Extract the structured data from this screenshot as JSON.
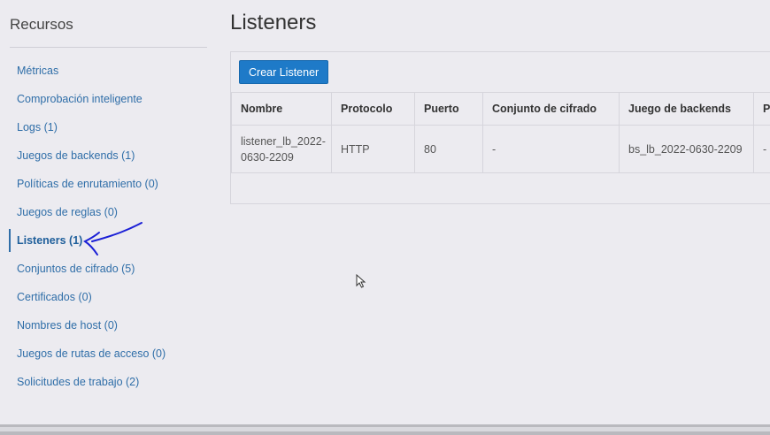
{
  "sidebar": {
    "title": "Recursos",
    "items": [
      {
        "label": "Métricas"
      },
      {
        "label": "Comprobación inteligente"
      },
      {
        "label": "Logs (1)"
      },
      {
        "label": "Juegos de backends (1)"
      },
      {
        "label": "Políticas de enrutamiento (0)"
      },
      {
        "label": "Juegos de reglas (0)"
      },
      {
        "label": "Listeners (1)",
        "active": true
      },
      {
        "label": "Conjuntos de cifrado (5)"
      },
      {
        "label": "Certificados (0)"
      },
      {
        "label": "Nombres de host (0)"
      },
      {
        "label": "Juegos de rutas de acceso (0)"
      },
      {
        "label": "Solicitudes de trabajo (2)"
      }
    ]
  },
  "main": {
    "title": "Listeners",
    "create_button": "Crear Listener",
    "table": {
      "headers": [
        "Nombre",
        "Protocolo",
        "Puerto",
        "Conjunto de cifrado",
        "Juego de backends",
        "Pe"
      ],
      "rows": [
        [
          "listener_lb_2022-0630-2209",
          "HTTP",
          "80",
          "-",
          "bs_lb_2022-0630-2209",
          "-"
        ]
      ]
    }
  },
  "colors": {
    "accent": "#1e7ac8",
    "link": "#2f6ea8",
    "annotation": "#1a1fd6"
  },
  "icons": {
    "cursor": "mouse-cursor-icon",
    "annotation": "hand-drawn-arrow"
  }
}
